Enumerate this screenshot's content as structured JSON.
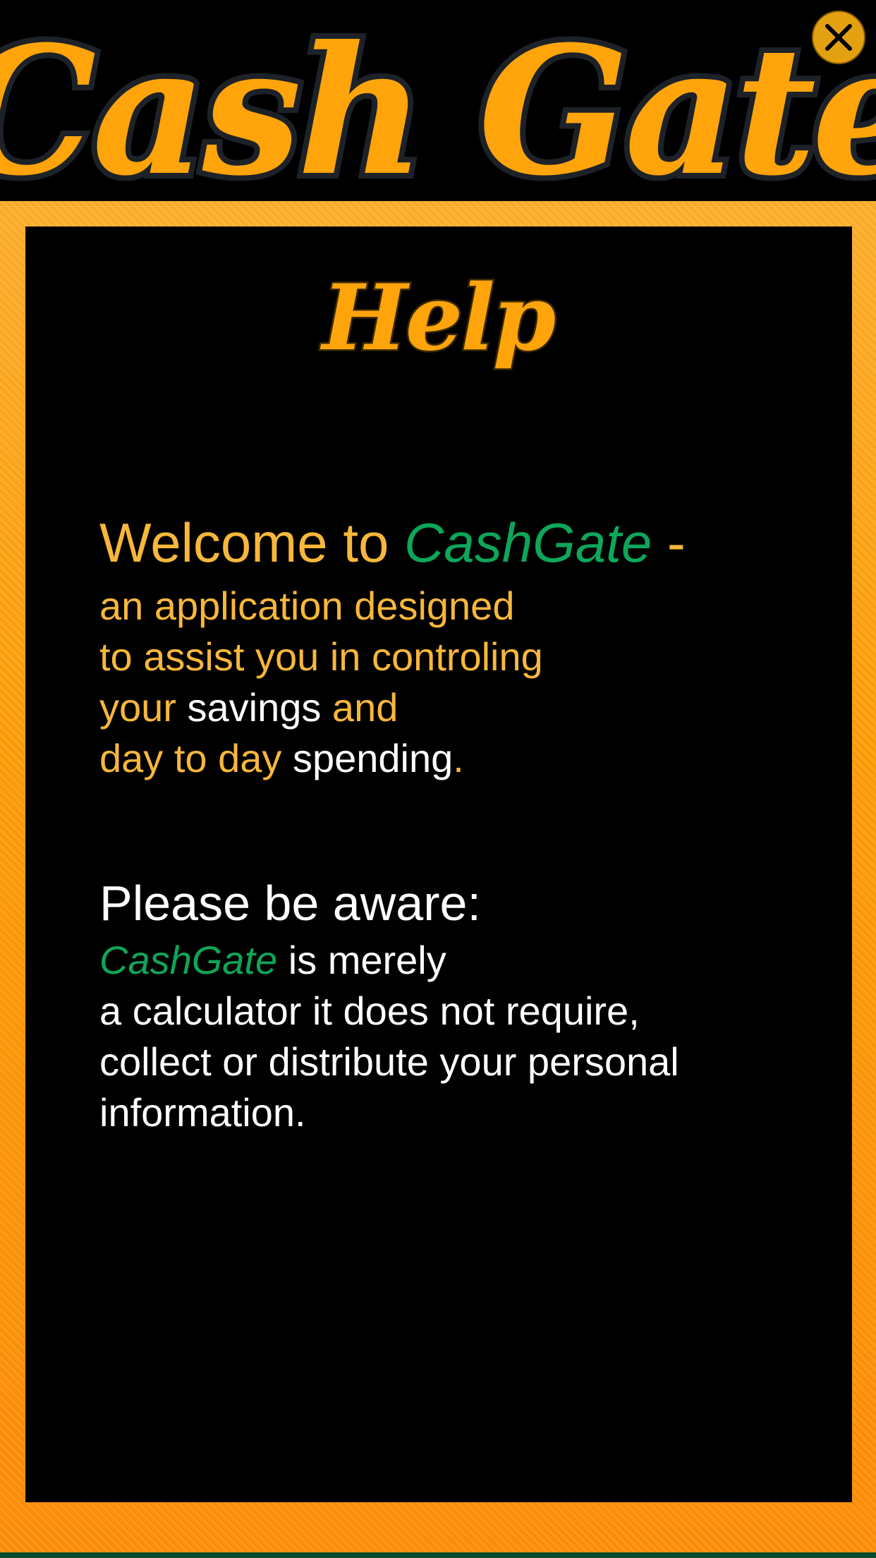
{
  "app": {
    "logo_text": "Cash Gate",
    "heading": "Help"
  },
  "close_button": {
    "icon": "close-icon"
  },
  "welcome": {
    "prefix": "Welcome to ",
    "brand": "CashGate",
    "dash": " -",
    "line1": "an application designed",
    "line2": "to assist you in controling",
    "line3_a": "your ",
    "line3_b": "savings",
    "line3_c": " and",
    "line4_a": "day to day ",
    "line4_b": "spending",
    "line4_c": "."
  },
  "aware": {
    "title": "Please be aware:",
    "brand": "CashGate",
    "line1_rest": " is merely",
    "line2": "a calculator it does not require,",
    "line3": "collect or distribute your personal",
    "line4": "information."
  },
  "colors": {
    "accent_orange": "#ffa40b",
    "text_orange": "#f7b73b",
    "brand_green": "#0ea65a",
    "close_gold": "#e3a112"
  }
}
